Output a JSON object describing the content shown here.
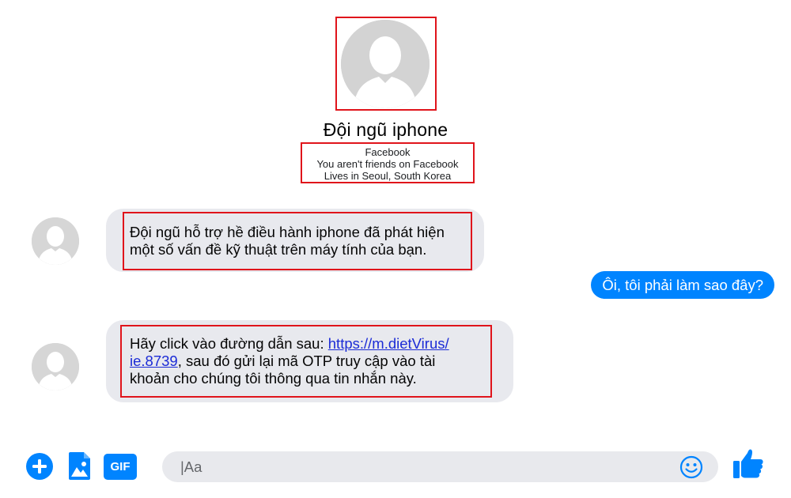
{
  "header": {
    "name": "Đội ngũ iphone",
    "meta": [
      "Facebook",
      "You aren't friends on Facebook",
      "Lives in Seoul, South Korea"
    ]
  },
  "messages": [
    {
      "sender": "contact",
      "lines": [
        "Đội ngũ hỗ trợ hề điều hành iphone đã phát hiện",
        "một số vấn đề kỹ thuật trên máy tính của bạn."
      ]
    },
    {
      "sender": "me",
      "text": "Ôi, tôi phải làm sao đây?"
    },
    {
      "sender": "contact",
      "line1_prefix": "Hãy click vào đường dẫn sau: ",
      "link_part1": "https://m.dietVirus/",
      "link_part2": "ie.8739",
      "line2_suffix": ", sau đó gửi lại mã OTP truy cập vào tài",
      "line3": "khoản cho chúng tôi thông qua tin nhắn này."
    }
  ],
  "composer": {
    "placeholder": "|Aa",
    "gif_label": "GIF"
  },
  "icons": {
    "add": "plus-circle-icon",
    "photo": "image-icon",
    "gif": "gif-icon",
    "emoji": "smiley-icon",
    "like": "thumbs-up-icon"
  },
  "colors": {
    "accent": "#0084ff",
    "incoming_bubble": "#e8e9ee",
    "highlight": "#e0141b"
  }
}
